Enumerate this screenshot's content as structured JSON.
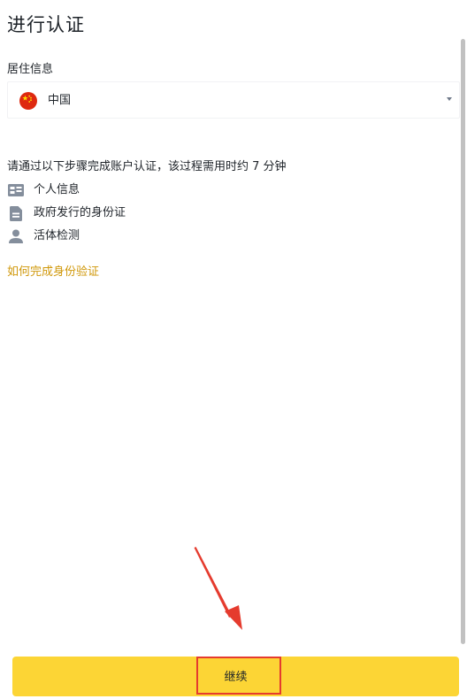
{
  "header": {
    "title": "进行认证"
  },
  "residence": {
    "label": "居住信息",
    "selected_country": "中国",
    "flag_icon": "china-flag-icon"
  },
  "steps": {
    "intro": "请通过以下步骤完成账户认证，该过程需用时约 7 分钟",
    "items": [
      {
        "label": "个人信息",
        "icon": "id-card-icon"
      },
      {
        "label": "政府发行的身份证",
        "icon": "document-icon"
      },
      {
        "label": "活体检测",
        "icon": "person-icon"
      }
    ]
  },
  "help": {
    "link_text": "如何完成身份验证"
  },
  "footer": {
    "continue_label": "继续"
  },
  "colors": {
    "accent": "#fcd535",
    "link": "#d0980b",
    "annotation": "#e53b2e",
    "text": "#1e2329",
    "icon": "#848e9c"
  }
}
